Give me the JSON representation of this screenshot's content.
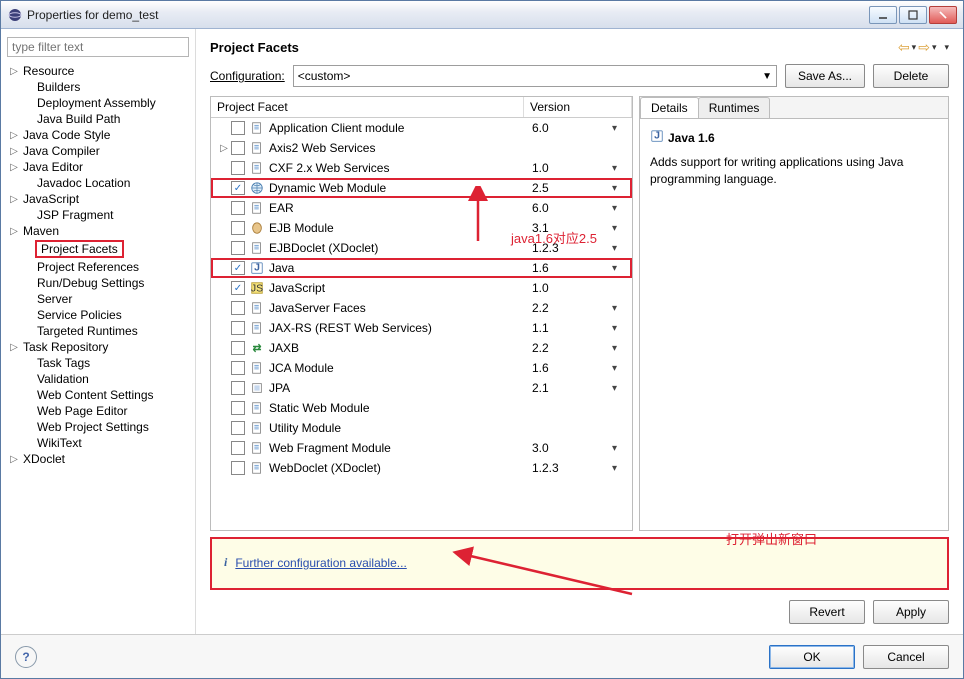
{
  "window": {
    "title": "Properties for demo_test"
  },
  "sidebar": {
    "filter_placeholder": "type filter text",
    "items": [
      {
        "label": "Resource",
        "children": true,
        "depth": 0
      },
      {
        "label": "Builders",
        "depth": 1
      },
      {
        "label": "Deployment Assembly",
        "depth": 1
      },
      {
        "label": "Java Build Path",
        "depth": 1
      },
      {
        "label": "Java Code Style",
        "children": true,
        "depth": 0
      },
      {
        "label": "Java Compiler",
        "children": true,
        "depth": 0
      },
      {
        "label": "Java Editor",
        "children": true,
        "depth": 0
      },
      {
        "label": "Javadoc Location",
        "depth": 1
      },
      {
        "label": "JavaScript",
        "children": true,
        "depth": 0
      },
      {
        "label": "JSP Fragment",
        "depth": 1
      },
      {
        "label": "Maven",
        "children": true,
        "depth": 0
      },
      {
        "label": "Project Facets",
        "depth": 1,
        "selected": true
      },
      {
        "label": "Project References",
        "depth": 1
      },
      {
        "label": "Run/Debug Settings",
        "depth": 1
      },
      {
        "label": "Server",
        "depth": 1
      },
      {
        "label": "Service Policies",
        "depth": 1
      },
      {
        "label": "Targeted Runtimes",
        "depth": 1
      },
      {
        "label": "Task Repository",
        "children": true,
        "depth": 0
      },
      {
        "label": "Task Tags",
        "depth": 1
      },
      {
        "label": "Validation",
        "depth": 1
      },
      {
        "label": "Web Content Settings",
        "depth": 1
      },
      {
        "label": "Web Page Editor",
        "depth": 1
      },
      {
        "label": "Web Project Settings",
        "depth": 1
      },
      {
        "label": "WikiText",
        "depth": 1
      },
      {
        "label": "XDoclet",
        "children": true,
        "depth": 0
      }
    ]
  },
  "main": {
    "title": "Project Facets",
    "config_label": "Configuration:",
    "config_value": "<custom>",
    "save_as": "Save As...",
    "delete": "Delete",
    "columns": {
      "name": "Project Facet",
      "version": "Version"
    },
    "facets": [
      {
        "name": "Application Client module",
        "version": "6.0",
        "drop": true,
        "icon": "doc"
      },
      {
        "name": "Axis2 Web Services",
        "version": "",
        "drop": false,
        "icon": "doc",
        "expandable": true
      },
      {
        "name": "CXF 2.x Web Services",
        "version": "1.0",
        "drop": true,
        "icon": "doc"
      },
      {
        "name": "Dynamic Web Module",
        "version": "2.5",
        "drop": true,
        "checked": true,
        "icon": "globe",
        "highlight": true
      },
      {
        "name": "EAR",
        "version": "6.0",
        "drop": true,
        "icon": "doc"
      },
      {
        "name": "EJB Module",
        "version": "3.1",
        "drop": true,
        "icon": "bean"
      },
      {
        "name": "EJBDoclet (XDoclet)",
        "version": "1.2.3",
        "drop": true,
        "icon": "doc"
      },
      {
        "name": "Java",
        "version": "1.6",
        "drop": true,
        "checked": true,
        "icon": "java",
        "highlight": true
      },
      {
        "name": "JavaScript",
        "version": "1.0",
        "drop": false,
        "checked": true,
        "icon": "js"
      },
      {
        "name": "JavaServer Faces",
        "version": "2.2",
        "drop": true,
        "icon": "doc"
      },
      {
        "name": "JAX-RS (REST Web Services)",
        "version": "1.1",
        "drop": true,
        "icon": "doc"
      },
      {
        "name": "JAXB",
        "version": "2.2",
        "drop": true,
        "icon": "jaxb"
      },
      {
        "name": "JCA Module",
        "version": "1.6",
        "drop": true,
        "icon": "doc"
      },
      {
        "name": "JPA",
        "version": "2.1",
        "drop": true,
        "icon": "jpa"
      },
      {
        "name": "Static Web Module",
        "version": "",
        "drop": false,
        "icon": "doc"
      },
      {
        "name": "Utility Module",
        "version": "",
        "drop": false,
        "icon": "doc"
      },
      {
        "name": "Web Fragment Module",
        "version": "3.0",
        "drop": true,
        "icon": "doc"
      },
      {
        "name": "WebDoclet (XDoclet)",
        "version": "1.2.3",
        "drop": true,
        "icon": "doc"
      }
    ],
    "details": {
      "tabs": [
        "Details",
        "Runtimes"
      ],
      "title": "Java 1.6",
      "desc": "Adds support for writing applications using Java programming language."
    },
    "info_link": "Further configuration available...",
    "revert": "Revert",
    "apply": "Apply"
  },
  "footer": {
    "ok": "OK",
    "cancel": "Cancel"
  },
  "annotations": {
    "facet_note": "java1.6对应2.5",
    "info_note": "打开弹出新窗口"
  }
}
